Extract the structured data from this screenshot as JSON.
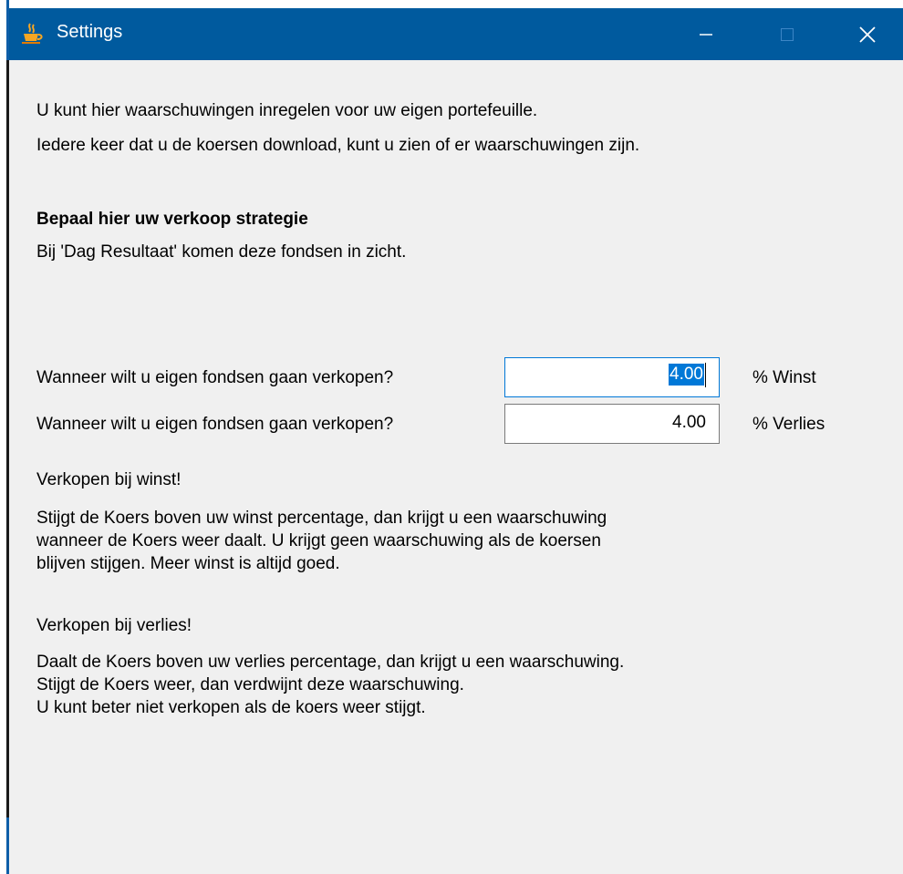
{
  "window": {
    "title": "Settings",
    "icon": "java-cup-icon",
    "controls": {
      "minimize": "minimize-icon",
      "maximize": "maximize-icon",
      "close": "close-icon"
    }
  },
  "intro": {
    "line1": "U kunt hier waarschuwingen inregelen voor uw eigen portefeuille.",
    "line2": "Iedere keer dat u de koersen download, kunt u zien of er waarschuwingen zijn."
  },
  "strategy": {
    "heading": "Bepaal hier uw verkoop strategie",
    "subtext": "Bij 'Dag Resultaat'  komen deze fondsen in zicht."
  },
  "fields": [
    {
      "question": "Wanneer wilt u eigen fondsen gaan verkopen?",
      "value": "4.00",
      "unit": "% Winst",
      "selected": true
    },
    {
      "question": "Wanneer wilt u eigen fondsen gaan verkopen?",
      "value": "4.00",
      "unit": "% Verlies",
      "selected": false
    }
  ],
  "win_section": {
    "heading": "Verkopen bij winst!",
    "lines": [
      "Stijgt de Koers boven uw winst percentage, dan krijgt u een waarschuwing",
      "wanneer de Koers weer daalt. U krijgt geen waarschuwing als de koersen",
      "blijven stijgen. Meer winst is altijd goed."
    ]
  },
  "loss_section": {
    "heading": "Verkopen bij verlies!",
    "lines": [
      "Daalt de Koers boven uw verlies percentage, dan krijgt u een waarschuwing.",
      "Stijgt de Koers weer, dan verdwijnt deze waarschuwing.",
      "U kunt beter niet verkopen als de koers weer stijgt."
    ]
  },
  "colors": {
    "titlebar": "#005a9e",
    "background": "#f0f0f0",
    "selection": "#0078d7"
  }
}
